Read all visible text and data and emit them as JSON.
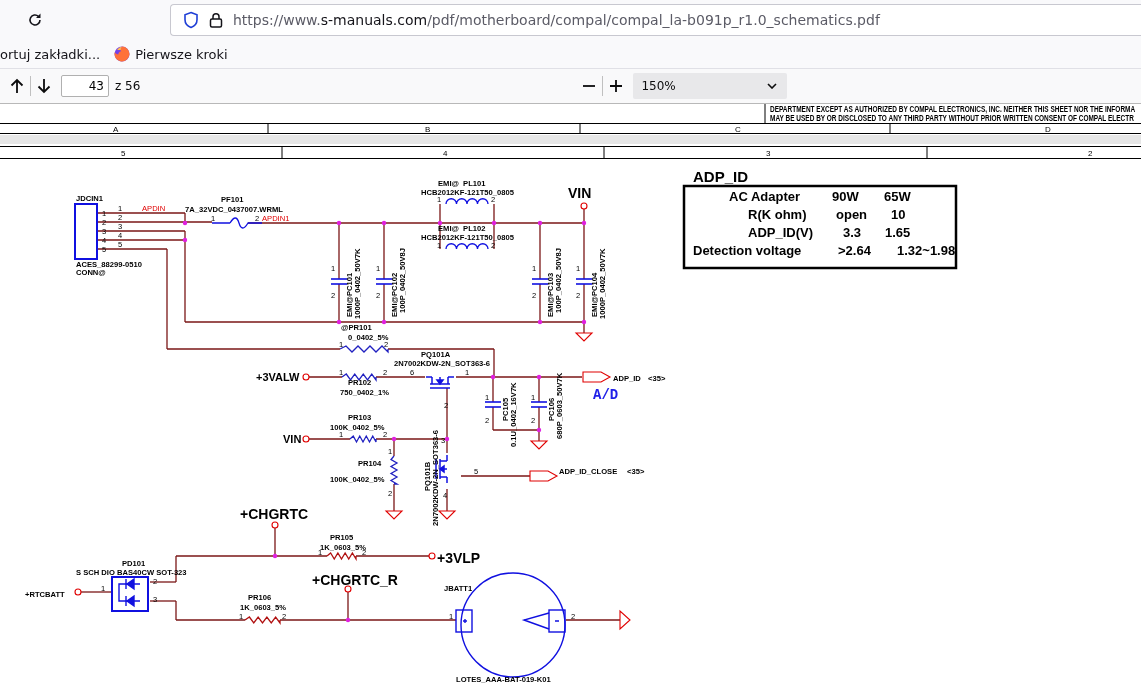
{
  "browser": {
    "url_scheme": "https://www.",
    "url_domain": "s-manuals.com",
    "url_path": "/pdf/motherboard/compal/compal_la-b091p_r1.0_schematics.pdf"
  },
  "bookmarks": [
    {
      "label": "ortuj zakładki...",
      "kind": "plain"
    },
    {
      "label": "Pierwsze kroki",
      "kind": "firefox"
    }
  ],
  "pdf_toolbar": {
    "page": "43",
    "page_count": "z 56",
    "zoom": "150%"
  },
  "sheet": {
    "notice": [
      "DEPARTMENT EXCEPT AS AUTHORIZED BY COMPAL ELECTRONICS, INC. NEITHER THIS SHEET NOR THE INFORMA",
      "MAY BE USED BY OR DISCLOSED TO ANY THIRD PARTY WITHOUT PRIOR WRITTEN CONSENT OF COMPAL ELECTR"
    ],
    "columns": [
      "A",
      "B",
      "C",
      "D"
    ],
    "rows": [
      "5",
      "4",
      "3",
      "2"
    ]
  },
  "schematic": {
    "labels": [
      {
        "text": "JDCIN1",
        "kind": "part"
      },
      {
        "text": "1",
        "kind": "pin"
      },
      {
        "text": "2",
        "kind": "pin"
      },
      {
        "text": "3",
        "kind": "pin"
      },
      {
        "text": "4",
        "kind": "pin"
      },
      {
        "text": "5",
        "kind": "pin"
      },
      {
        "text": "1",
        "kind": "pin"
      },
      {
        "text": "2",
        "kind": "pin"
      },
      {
        "text": "3",
        "kind": "pin"
      },
      {
        "text": "4",
        "kind": "pin"
      },
      {
        "text": "5",
        "kind": "pin"
      },
      {
        "text": "APDIN",
        "kind": "signal"
      },
      {
        "text": "ACES_88299-0510",
        "kind": "part"
      },
      {
        "text": "CONN@",
        "kind": "part"
      },
      {
        "text": "PF101",
        "kind": "part"
      },
      {
        "text": "7A_32VDC_0437007.WRML",
        "kind": "part"
      },
      {
        "text": "1",
        "kind": "pin"
      },
      {
        "text": "2",
        "kind": "pin"
      },
      {
        "text": "APDIN1",
        "kind": "signal"
      },
      {
        "text": "EMI@  PL101",
        "kind": "part"
      },
      {
        "text": "HCB2012KF-121T50_0805",
        "kind": "part"
      },
      {
        "text": "1",
        "kind": "pin"
      },
      {
        "text": "2",
        "kind": "pin"
      },
      {
        "text": "VIN",
        "kind": "rail"
      },
      {
        "text": "EMI@  PL102",
        "kind": "part"
      },
      {
        "text": "HCB2012KF-121T50_0805",
        "kind": "part"
      },
      {
        "text": "1",
        "kind": "pin"
      },
      {
        "text": "2",
        "kind": "pin"
      },
      {
        "text": "1",
        "kind": "pin"
      },
      {
        "text": "2",
        "kind": "pin"
      },
      {
        "text": "1",
        "kind": "pin"
      },
      {
        "text": "2",
        "kind": "pin"
      },
      {
        "text": "1",
        "kind": "pin"
      },
      {
        "text": "2",
        "kind": "pin"
      },
      {
        "text": "1",
        "kind": "pin"
      },
      {
        "text": "2",
        "kind": "pin"
      },
      {
        "text": "EMI@PC101",
        "kind": "part"
      },
      {
        "text": "1000P_0402_50V7K",
        "kind": "part"
      },
      {
        "text": "EMI@PC102",
        "kind": "part"
      },
      {
        "text": "100P_0402_50V8J",
        "kind": "part"
      },
      {
        "text": "EMI@PC103",
        "kind": "part"
      },
      {
        "text": "100P_0402_50V8J",
        "kind": "part"
      },
      {
        "text": "EMI@PC104",
        "kind": "part"
      },
      {
        "text": "1000P_0402_50V7K",
        "kind": "part"
      },
      {
        "text": "@PR101",
        "kind": "part"
      },
      {
        "text": "0_0402_5%",
        "kind": "part"
      },
      {
        "text": "1",
        "kind": "pin"
      },
      {
        "text": "2",
        "kind": "pin"
      },
      {
        "text": "PQ101A",
        "kind": "part"
      },
      {
        "text": "2N7002KDW-2N_SOT363-6",
        "kind": "part"
      },
      {
        "text": "+3VALW",
        "kind": "net"
      },
      {
        "text": "1",
        "kind": "pin"
      },
      {
        "text": "2",
        "kind": "pin"
      },
      {
        "text": "PR102",
        "kind": "part"
      },
      {
        "text": "750_0402_1%",
        "kind": "part"
      },
      {
        "text": "6",
        "kind": "pin"
      },
      {
        "text": "1",
        "kind": "pin"
      },
      {
        "text": "ADP_ID",
        "kind": "part"
      },
      {
        "text": "<35>",
        "kind": "part"
      },
      {
        "text": "1",
        "kind": "pin"
      },
      {
        "text": "2",
        "kind": "pin"
      },
      {
        "text": "PC105",
        "kind": "part"
      },
      {
        "text": "0.1U_0402_16V7K",
        "kind": "part"
      },
      {
        "text": "1",
        "kind": "pin"
      },
      {
        "text": "2",
        "kind": "pin"
      },
      {
        "text": "PC106",
        "kind": "part"
      },
      {
        "text": "680P_0603_50V7K",
        "kind": "part"
      },
      {
        "text": "A/D",
        "kind": "note"
      },
      {
        "text": "2",
        "kind": "pin"
      },
      {
        "text": "PR103",
        "kind": "part"
      },
      {
        "text": "100K_0402_5%",
        "kind": "part"
      },
      {
        "text": "VIN",
        "kind": "net"
      },
      {
        "text": "1",
        "kind": "pin"
      },
      {
        "text": "2",
        "kind": "pin"
      },
      {
        "text": "3",
        "kind": "pin"
      },
      {
        "text": "1",
        "kind": "pin"
      },
      {
        "text": "PR104",
        "kind": "part"
      },
      {
        "text": "100K_0402_5%",
        "kind": "part"
      },
      {
        "text": "2",
        "kind": "pin"
      },
      {
        "text": "PQ101B",
        "kind": "part"
      },
      {
        "text": "2N7002KDW-2N_SOT363-6",
        "kind": "part"
      },
      {
        "text": "5",
        "kind": "pin"
      },
      {
        "text": "4",
        "kind": "pin"
      },
      {
        "text": "ADP_ID_CLOSE",
        "kind": "part"
      },
      {
        "text": "<35>",
        "kind": "part"
      },
      {
        "text": "+CHGRTC",
        "kind": "rail"
      },
      {
        "text": "PR105",
        "kind": "part"
      },
      {
        "text": "1K_0603_5%",
        "kind": "part"
      },
      {
        "text": "1",
        "kind": "pin"
      },
      {
        "text": "2",
        "kind": "pin"
      },
      {
        "text": "+3VLP",
        "kind": "rail"
      },
      {
        "text": "PD101",
        "kind": "part"
      },
      {
        "text": "S SCH DIO BAS40CW SOT-323",
        "kind": "part"
      },
      {
        "text": "2",
        "kind": "pin"
      },
      {
        "text": "3",
        "kind": "pin"
      },
      {
        "text": "+RTCBATT",
        "kind": "part"
      },
      {
        "text": "1",
        "kind": "pin"
      },
      {
        "text": "+CHGRTC_R",
        "kind": "rail"
      },
      {
        "text": "PR106",
        "kind": "part"
      },
      {
        "text": "1K_0603_5%",
        "kind": "part"
      },
      {
        "text": "1",
        "kind": "pin"
      },
      {
        "text": "2",
        "kind": "pin"
      },
      {
        "text": "JBATT1",
        "kind": "part"
      },
      {
        "text": "1",
        "kind": "pin"
      },
      {
        "text": "2",
        "kind": "pin"
      },
      {
        "text": "LOTES_AAA-BAT-019-K01",
        "kind": "part"
      }
    ],
    "adp_table": {
      "title": "ADP_ID",
      "rows": [
        [
          "AC Adapter",
          "90W",
          "65W"
        ],
        [
          "R(K ohm)",
          "open",
          "10"
        ],
        [
          "ADP_ID(V)",
          "3.3",
          "1.65"
        ],
        [
          "Detection voltage",
          ">2.64",
          "1.32~1.98"
        ]
      ]
    }
  }
}
